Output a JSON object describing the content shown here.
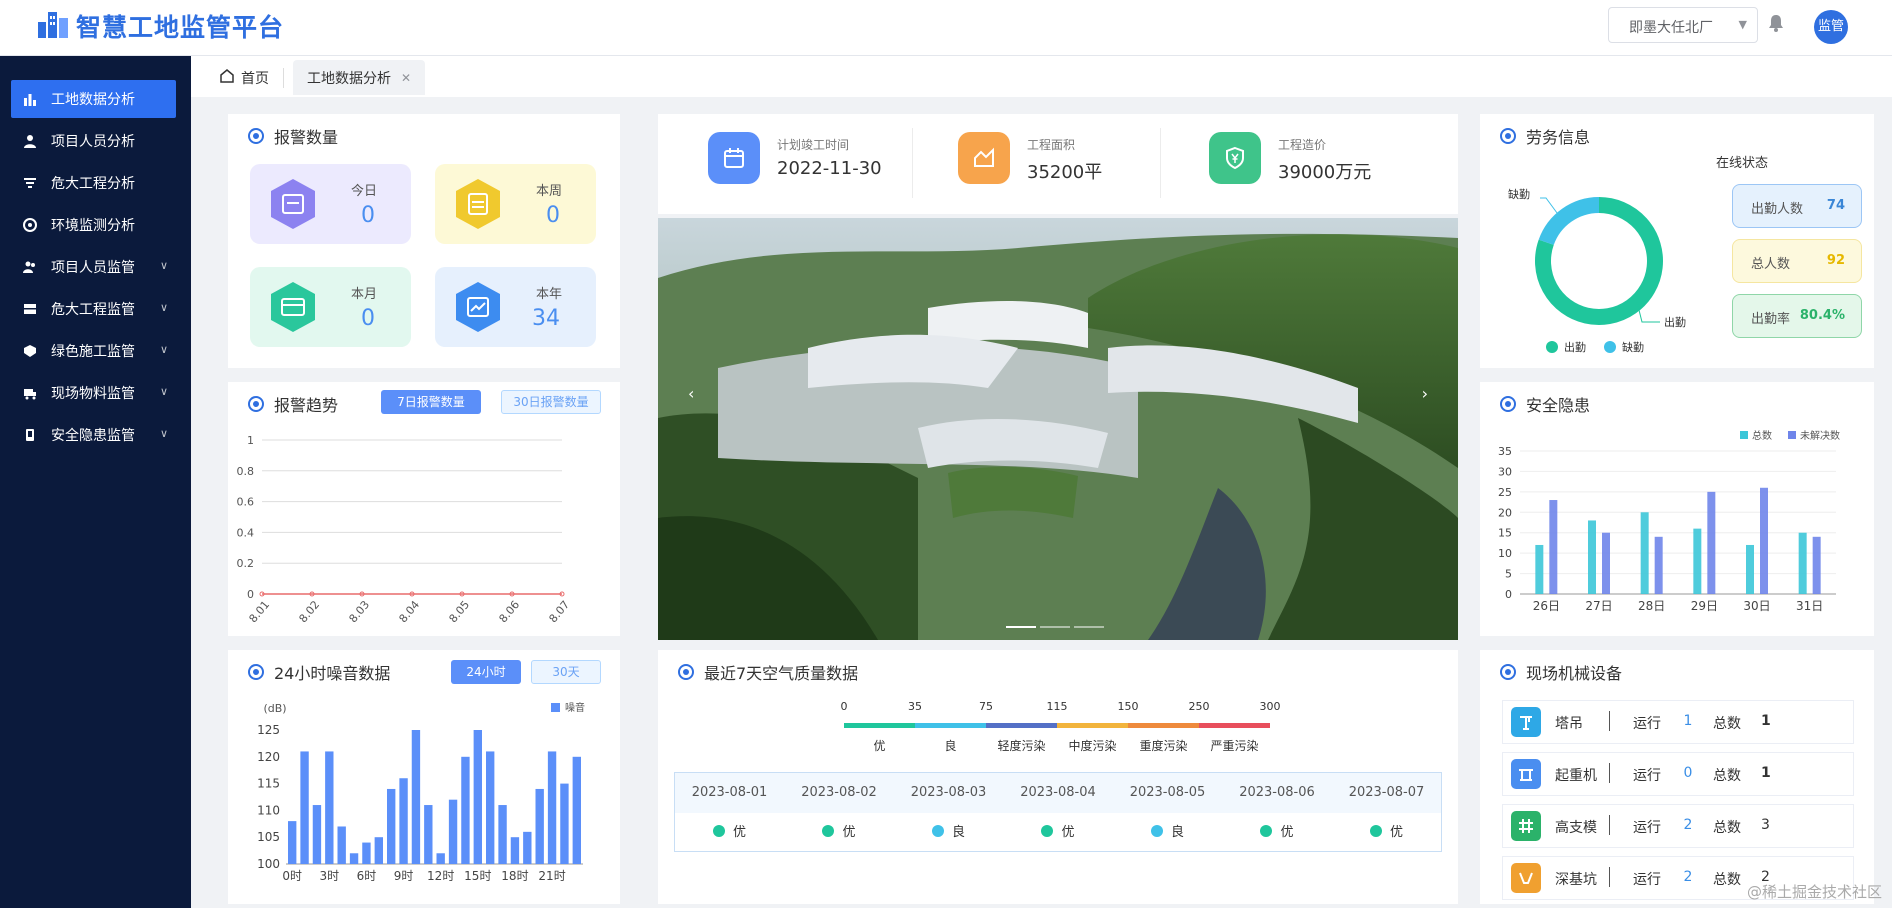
{
  "header": {
    "app_title": "智慧工地监管平台",
    "project_select": "即墨大任北厂",
    "avatar_label": "监管"
  },
  "sidebar": {
    "items": [
      {
        "label": "工地数据分析",
        "icon": "chart-bar-icon",
        "active": true
      },
      {
        "label": "项目人员分析",
        "icon": "user-icon"
      },
      {
        "label": "危大工程分析",
        "icon": "filter-icon"
      },
      {
        "label": "环境监测分析",
        "icon": "aperture-icon"
      },
      {
        "label": "项目人员监管",
        "icon": "users-icon",
        "has_children": true
      },
      {
        "label": "危大工程监管",
        "icon": "box-icon",
        "has_children": true
      },
      {
        "label": "绿色施工监管",
        "icon": "leaf-icon",
        "has_children": true
      },
      {
        "label": "现场物料监管",
        "icon": "truck-icon",
        "has_children": true
      },
      {
        "label": "安全隐患监管",
        "icon": "phone-icon",
        "has_children": true
      }
    ]
  },
  "tabs": {
    "home": "首页",
    "active": "工地数据分析"
  },
  "alarm_count": {
    "title": "报警数量",
    "items": [
      {
        "label": "今日",
        "value": "0",
        "color": "#8c82f0"
      },
      {
        "label": "本周",
        "value": "0",
        "color": "#f0c92e"
      },
      {
        "label": "本月",
        "value": "0",
        "color": "#2ac79c"
      },
      {
        "label": "本年",
        "value": "34",
        "color": "#3d8cf0"
      }
    ]
  },
  "alarm_trend": {
    "title": "报警趋势",
    "btn_7d": "7日报警数量",
    "btn_30d": "30日报警数量",
    "chart_data": {
      "type": "line",
      "categories": [
        "8.01",
        "8.02",
        "8.03",
        "8.04",
        "8.05",
        "8.06",
        "8.07"
      ],
      "values": [
        0,
        0,
        0,
        0,
        0,
        0,
        0
      ],
      "ylim": [
        0,
        1
      ],
      "yticks": [
        "1",
        "0.8",
        "0.6",
        "0.4",
        "0.2",
        "0"
      ]
    }
  },
  "noise": {
    "title": "24小时噪音数据",
    "btn_24h": "24小时",
    "btn_30d": "30天",
    "chart_data": {
      "type": "bar",
      "ylabel": "(dB)",
      "legend": "噪音",
      "ylim": [
        100,
        125
      ],
      "yticks": [
        "125",
        "120",
        "115",
        "110",
        "105",
        "100"
      ],
      "xticks": [
        "0时",
        "3时",
        "6时",
        "9时",
        "12时",
        "15时",
        "18时",
        "21时"
      ],
      "values": [
        108,
        121,
        111,
        121,
        107,
        102,
        104,
        105,
        114,
        116,
        125,
        111,
        102,
        112,
        120,
        125,
        121,
        111,
        105,
        106,
        114,
        121,
        115,
        120
      ]
    }
  },
  "project_info": [
    {
      "label": "计划竣工时间",
      "value": "2022-11-30",
      "icon": "calendar-icon",
      "color": "#5b8ff9"
    },
    {
      "label": "工程面积",
      "value": "35200平",
      "icon": "area-chart-icon",
      "color": "#f7a44c"
    },
    {
      "label": "工程造价",
      "value": "39000万元",
      "icon": "yuan-shield-icon",
      "color": "#3fc48a"
    }
  ],
  "air_quality": {
    "title": "最近7天空气质量数据",
    "scale_values": [
      "0",
      "35",
      "75",
      "115",
      "150",
      "250",
      "300"
    ],
    "levels": [
      {
        "label": "优",
        "color": "#1fc69c"
      },
      {
        "label": "良",
        "color": "#3fc1e8"
      },
      {
        "label": "轻度污染",
        "color": "#5470c6"
      },
      {
        "label": "中度污染",
        "color": "#f2b43c"
      },
      {
        "label": "重度污染",
        "color": "#ee8a3c"
      },
      {
        "label": "严重污染",
        "color": "#e84e5c"
      }
    ],
    "days": [
      {
        "date": "2023-08-01",
        "level": "优",
        "color": "#1fc69c"
      },
      {
        "date": "2023-08-02",
        "level": "优",
        "color": "#1fc69c"
      },
      {
        "date": "2023-08-03",
        "level": "良",
        "color": "#3fc1e8"
      },
      {
        "date": "2023-08-04",
        "level": "优",
        "color": "#1fc69c"
      },
      {
        "date": "2023-08-05",
        "level": "良",
        "color": "#3fc1e8"
      },
      {
        "date": "2023-08-06",
        "level": "优",
        "color": "#1fc69c"
      },
      {
        "date": "2023-08-07",
        "level": "优",
        "color": "#1fc69c"
      }
    ]
  },
  "labor": {
    "title": "劳务信息",
    "status_title": "在线状态",
    "chart_data": {
      "type": "pie",
      "slices": [
        {
          "name": "出勤",
          "value": 74,
          "color": "#1fc69c"
        },
        {
          "name": "缺勤",
          "value": 18,
          "color": "#3fc1e8"
        }
      ]
    },
    "stats": [
      {
        "label": "出勤人数",
        "value": "74",
        "color": "#3a86d6"
      },
      {
        "label": "总人数",
        "value": "92",
        "color": "#e6b800"
      },
      {
        "label": "出勤率",
        "value": "80.4%",
        "color": "#2bb26a"
      }
    ]
  },
  "safety": {
    "title": "安全隐患",
    "chart_data": {
      "type": "bar",
      "categories": [
        "26日",
        "27日",
        "28日",
        "29日",
        "30日",
        "31日"
      ],
      "series": [
        {
          "name": "总数",
          "values": [
            12,
            18,
            20,
            16,
            12,
            15
          ]
        },
        {
          "name": "未解决数",
          "values": [
            23,
            15,
            14,
            25,
            26,
            14
          ]
        }
      ],
      "ylim": [
        0,
        35
      ],
      "yticks": [
        "35",
        "30",
        "25",
        "20",
        "15",
        "10",
        "5",
        "0"
      ]
    }
  },
  "machines": {
    "title": "现场机械设备",
    "run_label": "运行",
    "total_label": "总数",
    "items": [
      {
        "name": "塔吊",
        "running": "1",
        "total": "1",
        "icon": "tower-crane-icon",
        "color": "#2ea8e6"
      },
      {
        "name": "起重机",
        "running": "0",
        "total": "1",
        "icon": "crane-icon",
        "color": "#4a8ef0"
      },
      {
        "name": "高支模",
        "running": "2",
        "total": "3",
        "icon": "formwork-icon",
        "color": "#2bb26a"
      },
      {
        "name": "深基坑",
        "running": "2",
        "total": "2",
        "icon": "pit-icon",
        "color": "#f0a030"
      }
    ]
  },
  "watermark": "@稀土掘金技术社区"
}
